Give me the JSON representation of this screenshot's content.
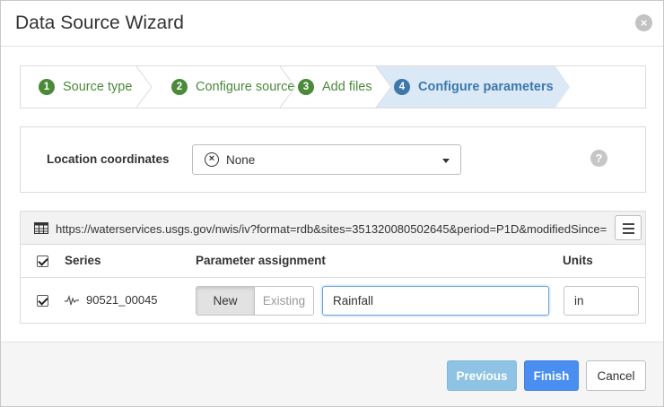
{
  "dialog": {
    "title": "Data Source Wizard",
    "close_icon": "close-circle-icon"
  },
  "steps": [
    {
      "number": "1",
      "label": "Source type",
      "state": "completed"
    },
    {
      "number": "2",
      "label": "Configure source",
      "state": "completed"
    },
    {
      "number": "3",
      "label": "Add files",
      "state": "completed"
    },
    {
      "number": "4",
      "label": "Configure parameters",
      "state": "active"
    }
  ],
  "location": {
    "label": "Location coordinates",
    "selected": "None",
    "help_icon": "question-circle-icon"
  },
  "source_table": {
    "url": "https://waterservices.usgs.gov/nwis/iv?format=rdb&sites=351320080502645&period=P1D&modifiedSince=",
    "columns": {
      "series": "Series",
      "parameter": "Parameter assignment",
      "units": "Units"
    },
    "rows": [
      {
        "checked": true,
        "series": "90521_00045",
        "mode_new": "New",
        "mode_existing": "Existing",
        "mode_selected": "New",
        "parameter": "Rainfall",
        "units": "in"
      }
    ]
  },
  "footer": {
    "previous": "Previous",
    "finish": "Finish",
    "cancel": "Cancel"
  },
  "colors": {
    "step_complete": "#4a8a39",
    "step_active": "#3d78ac",
    "step_active_bg": "#dbe9f6",
    "finish": "#4a8ef0",
    "previous_disabled": "#8ec3e3"
  }
}
